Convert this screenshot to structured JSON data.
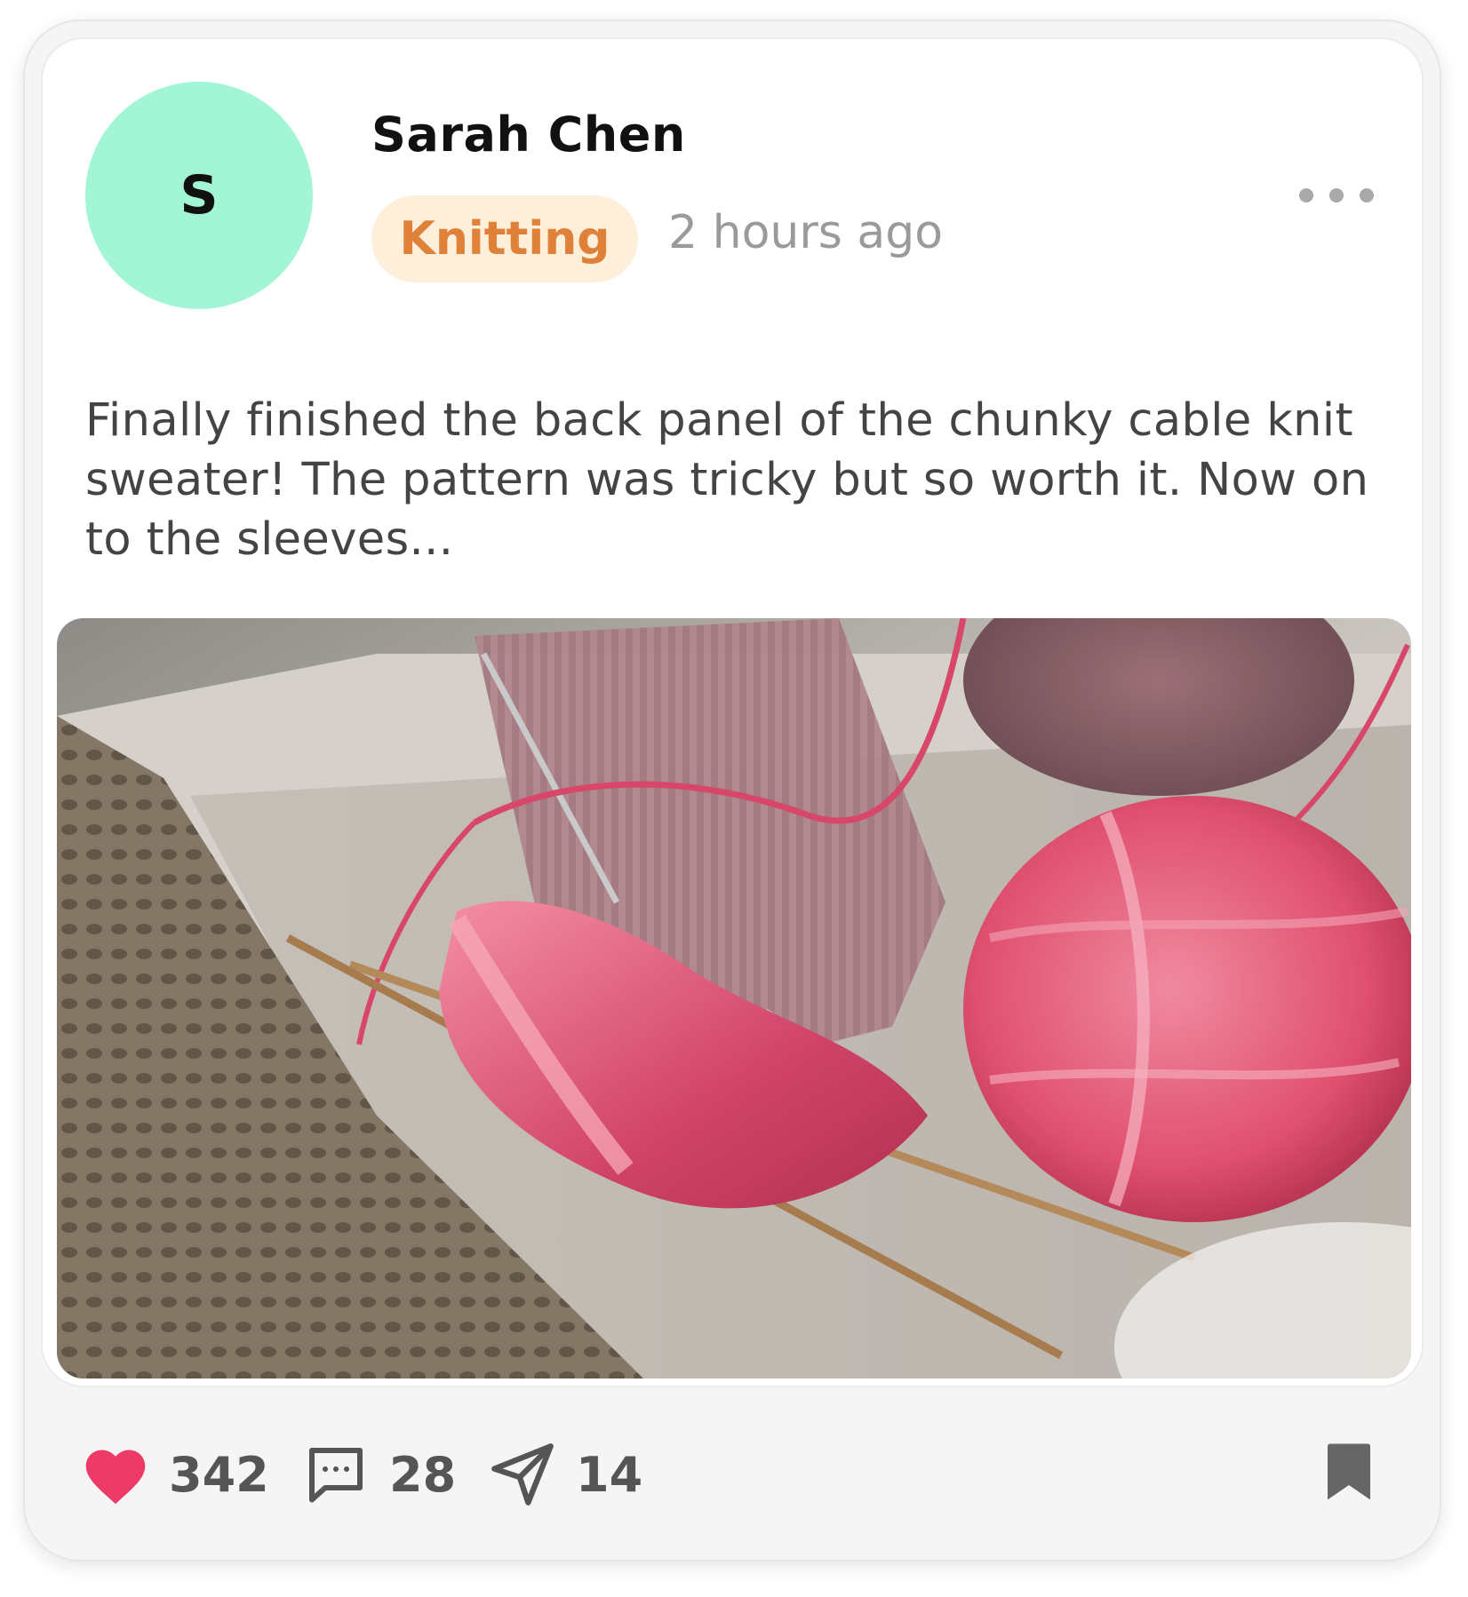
{
  "post": {
    "author": "Sarah Chen",
    "avatar_initial": "S",
    "avatar_color": "#a2f6d6",
    "tag": "Knitting",
    "tag_color": "#e0813a",
    "tag_bg": "#fdefd9",
    "time": "2 hours ago",
    "text": "Finally finished the back panel of the chunky cable knit sweater! The pattern was tricky but so worth it. Now on to the sleeves...",
    "image_icon": "photo-knitting-yarn"
  },
  "actions": {
    "likes": "342",
    "comments": "28",
    "shares": "14",
    "like_icon": "heart-icon",
    "like_color": "#ee3a67",
    "comment_icon": "comment-icon",
    "share_icon": "send-icon",
    "bookmark_icon": "bookmark-icon"
  }
}
